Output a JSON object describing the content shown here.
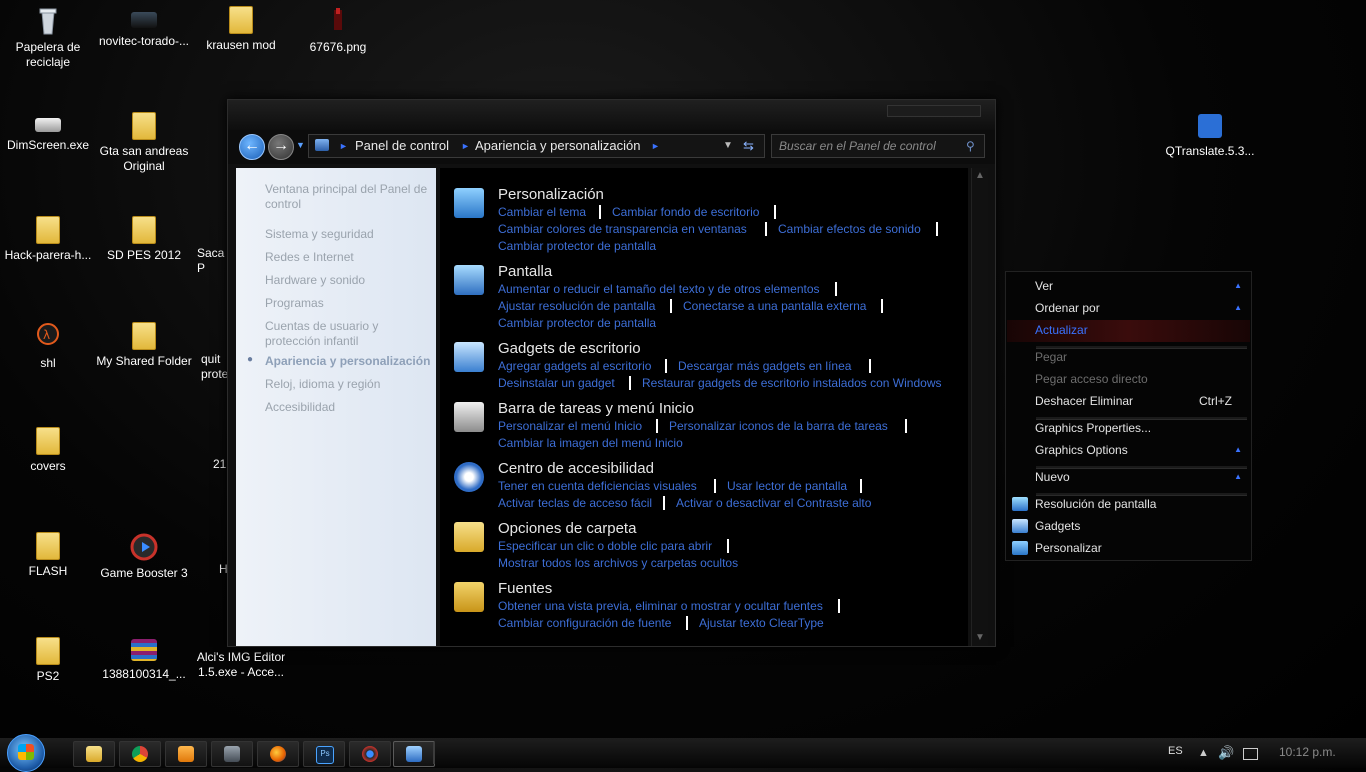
{
  "desktop": {
    "icons": [
      {
        "label": "Papelera de reciclaje",
        "icon": "recycle-bin-icon"
      },
      {
        "label": "novitec-torado-...",
        "icon": "image-file-icon"
      },
      {
        "label": "krausen mod",
        "icon": "folder-icon"
      },
      {
        "label": "67676.png",
        "icon": "image-file-icon"
      },
      {
        "label": "DimScreen.exe",
        "icon": "app-icon"
      },
      {
        "label": "Gta san andreas Original",
        "icon": "folder-icon"
      },
      {
        "label": "Hack-parera-h...",
        "icon": "folder-icon"
      },
      {
        "label": "SD PES 2012",
        "icon": "folder-icon"
      },
      {
        "label": "Saca P",
        "icon": "app-icon"
      },
      {
        "label": "shl",
        "icon": "shortcut-icon"
      },
      {
        "label": "My Shared Folder",
        "icon": "folder-icon"
      },
      {
        "label": "quit prote",
        "icon": "app-icon"
      },
      {
        "label": "covers",
        "icon": "folder-icon"
      },
      {
        "label": "21",
        "icon": "app-icon"
      },
      {
        "label": "FLASH",
        "icon": "folder-icon"
      },
      {
        "label": "Game Booster 3",
        "icon": "game-booster-icon"
      },
      {
        "label": "H",
        "icon": "app-icon"
      },
      {
        "label": "PS2",
        "icon": "folder-icon"
      },
      {
        "label": "1388100314_...",
        "icon": "archive-icon"
      },
      {
        "label": "Alci's IMG Editor 1.5.exe - Acce...",
        "icon": "shortcut-icon"
      },
      {
        "label": "QTranslate.5.3...",
        "icon": "translate-icon"
      }
    ]
  },
  "window": {
    "breadcrumb": [
      "Panel de control",
      "Apariencia y personalización"
    ],
    "search_placeholder": "Buscar en el Panel de control",
    "sidebar": [
      "Ventana principal del Panel de control",
      "Sistema y seguridad",
      "Redes e Internet",
      "Hardware y sonido",
      "Programas",
      "Cuentas de usuario y protección infantil",
      "Apariencia y personalización",
      "Reloj, idioma y región",
      "Accesibilidad"
    ],
    "categories": [
      {
        "title": "Personalización",
        "icon": "personalization-icon",
        "links": [
          "Cambiar el tema",
          "Cambiar fondo de escritorio",
          "Cambiar colores de transparencia en ventanas",
          "Cambiar efectos de sonido",
          "Cambiar protector de pantalla"
        ]
      },
      {
        "title": "Pantalla",
        "icon": "display-icon",
        "links": [
          "Aumentar o reducir el tamaño del texto y de otros elementos",
          "Ajustar resolución de pantalla",
          "Conectarse a una pantalla externa",
          "Cambiar protector de pantalla"
        ]
      },
      {
        "title": "Gadgets de escritorio",
        "icon": "gadgets-icon",
        "links": [
          "Agregar gadgets al escritorio",
          "Descargar más gadgets en línea",
          "Desinstalar un gadget",
          "Restaurar gadgets de escritorio instalados con Windows"
        ]
      },
      {
        "title": "Barra de tareas y menú Inicio",
        "icon": "taskbar-icon",
        "links": [
          "Personalizar el menú Inicio",
          "Personalizar iconos de la barra de tareas",
          "Cambiar la imagen del menú Inicio"
        ]
      },
      {
        "title": "Centro de accesibilidad",
        "icon": "accessibility-icon",
        "links": [
          "Tener en cuenta deficiencias visuales",
          "Usar lector de pantalla",
          "Activar teclas de acceso fácil",
          "Activar o desactivar el Contraste alto"
        ]
      },
      {
        "title": "Opciones de carpeta",
        "icon": "folder-options-icon",
        "links": [
          "Especificar un clic o doble clic para abrir",
          "Mostrar todos los archivos y carpetas ocultos"
        ]
      },
      {
        "title": "Fuentes",
        "icon": "fonts-icon",
        "links": [
          "Obtener una vista previa, eliminar o mostrar y ocultar fuentes",
          "Cambiar configuración de fuente",
          "Ajustar texto ClearType"
        ]
      }
    ]
  },
  "context_menu": {
    "items": [
      {
        "label": "Ver",
        "submenu": true
      },
      {
        "label": "Ordenar por",
        "submenu": true
      },
      {
        "label": "Actualizar",
        "highlighted": true
      },
      {
        "label": "Pegar",
        "disabled": true
      },
      {
        "label": "Pegar acceso directo",
        "disabled": true
      },
      {
        "label": "Deshacer Eliminar",
        "shortcut": "Ctrl+Z"
      },
      {
        "label": "Graphics Properties..."
      },
      {
        "label": "Graphics Options",
        "submenu": true
      },
      {
        "label": "Nuevo",
        "submenu": true
      },
      {
        "label": "Resolución de pantalla",
        "icon": "display-resolution-icon"
      },
      {
        "label": "Gadgets",
        "icon": "gadgets-icon"
      },
      {
        "label": "Personalizar",
        "icon": "personalize-icon"
      }
    ]
  },
  "taskbar": {
    "apps": [
      "explorer-icon",
      "chrome-icon",
      "media-player-icon",
      "game-controller-icon",
      "firefox-icon",
      "photoshop-icon",
      "game-booster-icon",
      "control-panel-icon"
    ],
    "photoshop_label": "Ps",
    "language": "ES",
    "clock": "10:12 p.m."
  }
}
